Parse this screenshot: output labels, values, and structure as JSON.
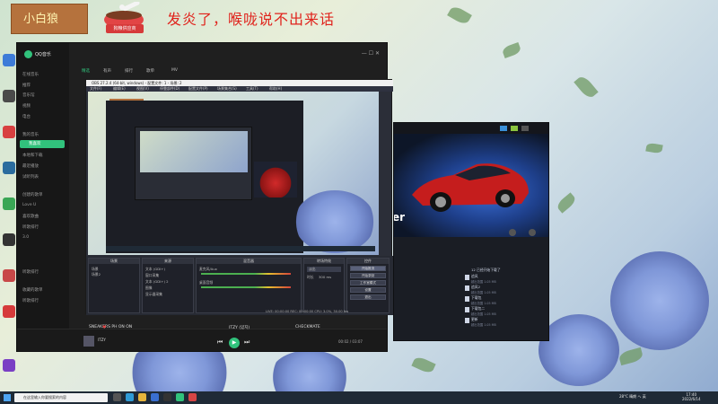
{
  "overlay": {
    "brand": "小白狼",
    "bowl_tag": "狗粮供应商",
    "message": "发炎了，喉咙说不出来话"
  },
  "qq": {
    "title": "QQ音乐",
    "tabs": [
      "精选",
      "有声",
      "排行",
      "歌单",
      "MV"
    ],
    "sidebar": [
      "在线音乐",
      "推荐",
      "音乐馆",
      "视频",
      "电台",
      "我的音乐",
      "我喜欢",
      "本地和下载",
      "最近播放",
      "试听列表",
      "创建的歌单",
      "Love U",
      "喜欢歌曲",
      "听歌排行",
      "3.0",
      "听歌排行",
      "收藏的歌单",
      "听歌排行"
    ],
    "now_playing_bar": "SNEAKERS  PH ON  ON",
    "now_playing_mid": "ITZY (있지)",
    "now_playing_right": "CHECKMATE",
    "track_name": "ITZY",
    "track_time": "00:02 / 03:07",
    "controls": {
      "prev": "⏮",
      "play": "▶",
      "next": "⏭",
      "heart": "♥"
    }
  },
  "obs": {
    "title": "OBS 27.2.4 (64-bit, windows) - 配置文件: 1 - 场景: 2",
    "menu": [
      "文件(F)",
      "编辑(E)",
      "视图(V)",
      "停靠部件(D)",
      "配置文件(P)",
      "场景集合(S)",
      "工具(T)",
      "帮助(H)"
    ],
    "panels": {
      "scenes": "场景",
      "sources": "来源",
      "mixer": "混音器",
      "transitions": "转场特效",
      "controls": "控件"
    },
    "scenes": [
      "场景",
      "场景2"
    ],
    "sources": [
      "文本 (GDI+)",
      "窗口采集",
      "文本 (GDI+) 2",
      "图像",
      "显示器采集"
    ],
    "mixer_rows": [
      "麦克风/Aux",
      "桌面音频"
    ],
    "transition": "淡出",
    "duration_label": "时长",
    "duration_value": "300 ms",
    "controls": [
      "开始推流",
      "开始录制",
      "工作室模式",
      "设置",
      "退出"
    ],
    "status": "LIVE: 00:00:00  REC: 00:00:00  CPU: 3.0%, 30.00 fps"
  },
  "car_app": {
    "label": "er",
    "list_header": "12 已经开始下载了",
    "list_items": [
      {
        "name": "追风",
        "sub": "超出范围 1.05 MB"
      },
      {
        "name": "追风2",
        "sub": "超出范围 1.05 MB"
      },
      {
        "name": "下载包",
        "sub": "超出范围 1.05 MB"
      },
      {
        "name": "下载包二",
        "sub": "超出范围 1.05 MB"
      },
      {
        "name": "更新",
        "sub": "超出范围 1.05 MB"
      }
    ]
  },
  "taskbar": {
    "search_placeholder": "在这里输入你要搜索的内容",
    "tray": "28°C 晴朗 へ 英",
    "time": "17:40",
    "date": "2022/6/14"
  }
}
